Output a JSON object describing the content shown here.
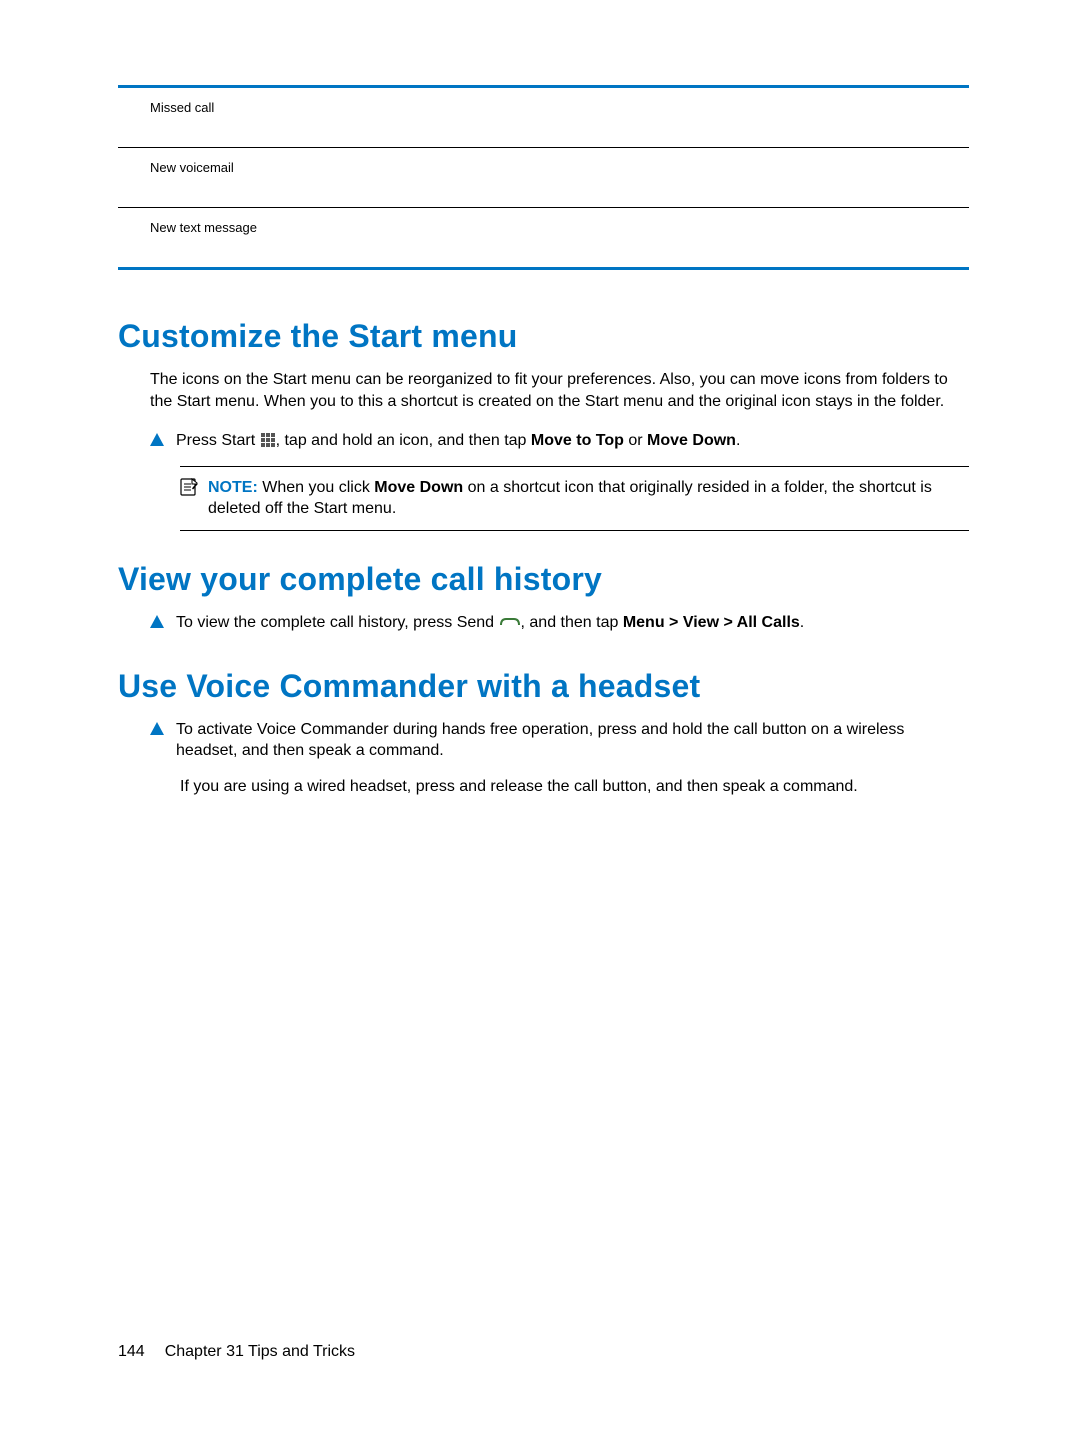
{
  "table_rows": [
    "Missed call",
    "New voicemail",
    "New text message"
  ],
  "section1": {
    "heading": "Customize the Start menu",
    "intro": "The icons on the Start menu can be reorganized to fit your preferences. Also, you can move icons from folders to the Start menu. When you to this a shortcut is created on the Start menu and the original icon stays in the folder.",
    "step_pre": "Press Start ",
    "step_mid": ", tap and hold an icon, and then tap ",
    "step_bold1": "Move to Top",
    "step_or": " or ",
    "step_bold2": "Move Down",
    "step_end": ".",
    "note_label": "NOTE:",
    "note_pre": "   When you click ",
    "note_bold": "Move Down",
    "note_post": " on a shortcut icon that originally resided in a folder, the shortcut is deleted off the Start menu."
  },
  "section2": {
    "heading": "View your complete call history",
    "step_pre": "To view the complete call history, press Send ",
    "step_mid": ", and then tap ",
    "step_bold": "Menu > View > All Calls",
    "step_end": "."
  },
  "section3": {
    "heading": "Use Voice Commander with a headset",
    "step": "To activate Voice Commander during hands free operation, press and hold the call button on a wireless headset, and then speak a command.",
    "para2": "If you are using a wired headset, press and release the call button, and then speak a command."
  },
  "footer": {
    "page_num": "144",
    "chapter": "Chapter 31   Tips and Tricks"
  }
}
